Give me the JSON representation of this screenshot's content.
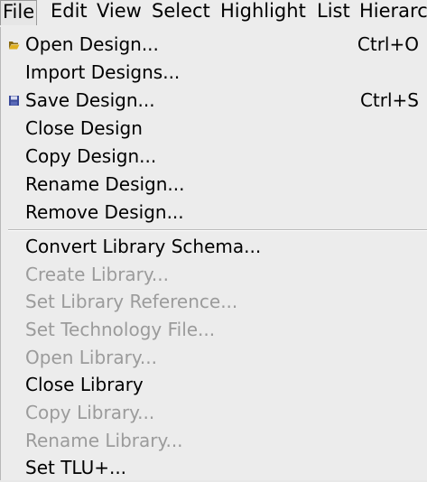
{
  "menubar": {
    "items": [
      {
        "label": "File"
      },
      {
        "label": "Edit"
      },
      {
        "label": "View"
      },
      {
        "label": "Select"
      },
      {
        "label": "Highlight"
      },
      {
        "label": "List"
      },
      {
        "label": "Hierarc"
      }
    ]
  },
  "file_menu": {
    "items": [
      {
        "label": "Open Design...",
        "accel": "Ctrl+O",
        "icon": "folder-open-icon",
        "enabled": true
      },
      {
        "label": "Import Designs...",
        "enabled": true
      },
      {
        "label": "Save Design...",
        "accel": "Ctrl+S",
        "icon": "floppy-disk-icon",
        "enabled": true
      },
      {
        "label": "Close Design",
        "enabled": true
      },
      {
        "label": "Copy Design...",
        "enabled": true
      },
      {
        "label": "Rename Design...",
        "enabled": true
      },
      {
        "label": "Remove Design...",
        "enabled": true
      },
      {
        "label": "Convert Library Schema...",
        "enabled": true
      },
      {
        "label": "Create Library...",
        "enabled": false
      },
      {
        "label": "Set Library Reference...",
        "enabled": false
      },
      {
        "label": "Set Technology File...",
        "enabled": false
      },
      {
        "label": "Open Library...",
        "enabled": false
      },
      {
        "label": "Close Library",
        "enabled": true
      },
      {
        "label": "Copy Library...",
        "enabled": false
      },
      {
        "label": "Rename Library...",
        "enabled": false
      },
      {
        "label": "Set TLU+...",
        "enabled": true
      }
    ]
  },
  "colors": {
    "menu_background": "#ececec",
    "text_enabled": "#000000",
    "text_disabled": "#9b9b9b",
    "folder_icon": "#e0b020",
    "floppy_icon": "#3a4a9a"
  }
}
